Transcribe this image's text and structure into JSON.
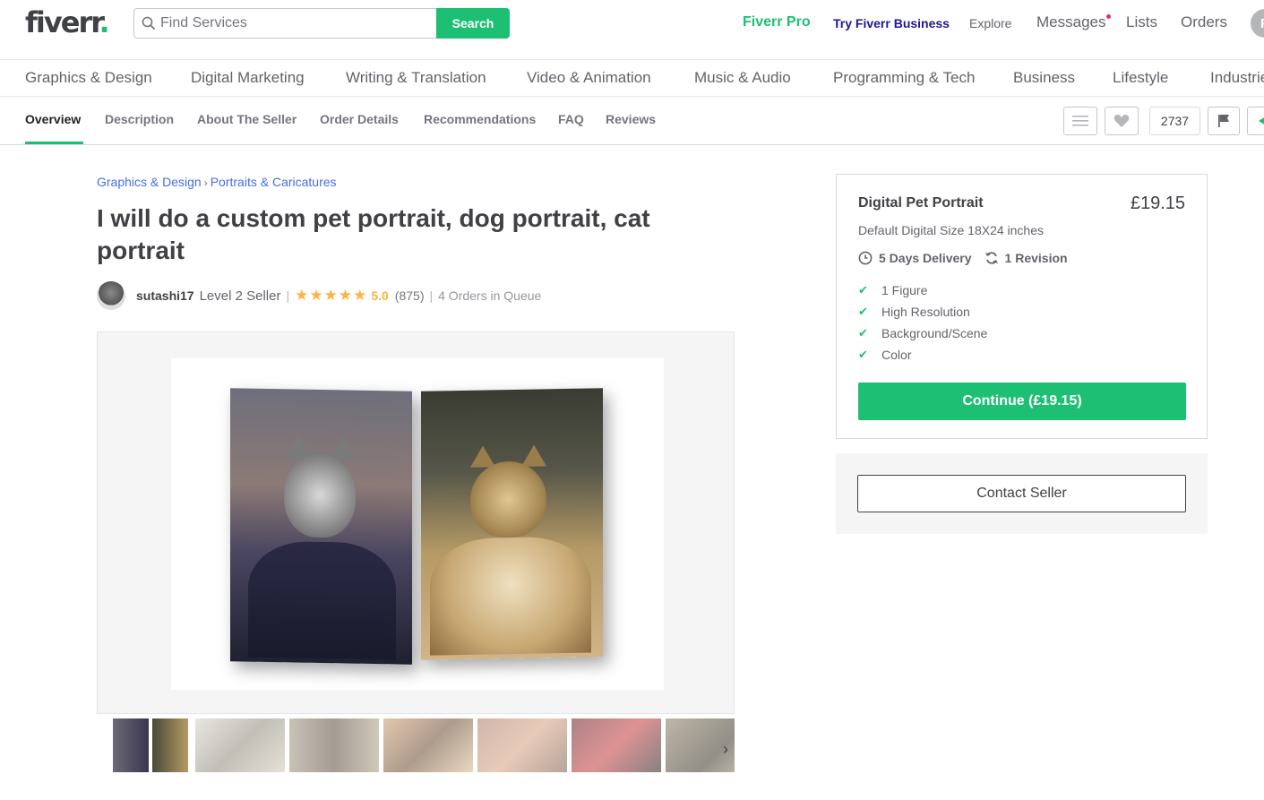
{
  "header": {
    "logo": "fiverr",
    "logo_dot": ".",
    "search_placeholder": "Find Services",
    "search_button": "Search",
    "nav": {
      "pro": "Fiverr Pro",
      "business": "Try Fiverr Business",
      "explore": "Explore",
      "messages": "Messages",
      "lists": "Lists",
      "orders": "Orders"
    },
    "avatar_initial": "P"
  },
  "categories": [
    "Graphics & Design",
    "Digital Marketing",
    "Writing & Translation",
    "Video & Animation",
    "Music & Audio",
    "Programming & Tech",
    "Business",
    "Lifestyle",
    "Industries"
  ],
  "subnav": {
    "items": [
      "Overview",
      "Description",
      "About The Seller",
      "Order Details",
      "Recommendations",
      "FAQ",
      "Reviews"
    ],
    "active": "Overview",
    "likes_count": "2737"
  },
  "breadcrumb": [
    "Graphics & Design",
    "Portraits & Caricatures"
  ],
  "breadcrumb_separator": "›",
  "gig": {
    "title": "I will do a custom pet portrait, dog portrait, cat portrait",
    "seller_name": "sutashi17",
    "seller_level": "Level 2 Seller",
    "stars": "★★★★★",
    "rating": "5.0",
    "reviews": "(875)",
    "queue": "4 Orders in Queue",
    "divider": "|"
  },
  "package": {
    "name": "Digital Pet Portrait",
    "price": "£19.15",
    "description": "Default Digital Size 18X24 inches",
    "delivery": "5 Days Delivery",
    "revisions": "1 Revision",
    "features": [
      "1 Figure",
      "High Resolution",
      "Background/Scene",
      "Color"
    ],
    "check_glyph": "✔",
    "continue_button": "Continue (£19.15)"
  },
  "contact_button": "Contact Seller",
  "thumb_next": "›",
  "colors": {
    "brand_green": "#1dbf73",
    "link_blue": "#446ee7",
    "star_gold": "#ffb33e",
    "business_navy": "#1e1692"
  }
}
